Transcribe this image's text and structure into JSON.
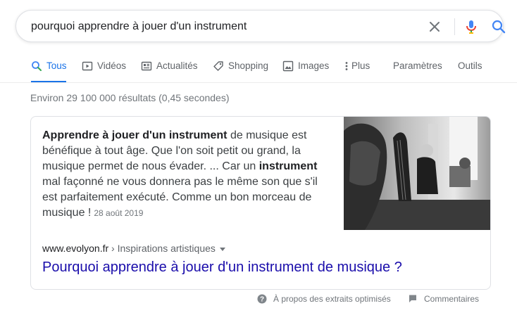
{
  "search": {
    "query": "pourquoi apprendre à jouer d'un instrument"
  },
  "tabs": [
    {
      "label": "Tous"
    },
    {
      "label": "Vidéos"
    },
    {
      "label": "Actualités"
    },
    {
      "label": "Shopping"
    },
    {
      "label": "Images"
    },
    {
      "label": "Plus"
    },
    {
      "label": "Paramètres"
    },
    {
      "label": "Outils"
    }
  ],
  "results_stats": "Environ 29 100 000 résultats (0,45 secondes)",
  "featured_snippet": {
    "bold_1": "Apprendre à jouer d'un instrument",
    "text_1": " de musique est bénéfique à tout âge. Que l'on soit petit ou grand, la musique permet de nous évader. ... Car un ",
    "bold_2": "instrument",
    "text_2": " mal façonné ne vous donnera pas le même son que s'il est parfaitement exécuté. Comme un bon morceau de musique !",
    "date": "28 août 2019",
    "domain": "www.evolyon.fr",
    "breadcrumb": " › Inspirations artistiques",
    "title": "Pourquoi apprendre à jouer d'un instrument de musique ?"
  },
  "footer": {
    "about": "À propos des extraits optimisés",
    "feedback": "Commentaires"
  },
  "colors": {
    "link_title": "#1a0dab",
    "active_tab": "#1a73e8",
    "muted_text": "#70757a"
  },
  "icons": {
    "clear": "close-icon",
    "voice": "microphone-icon",
    "search": "search-icon",
    "about": "help-circle-icon",
    "feedback": "feedback-flag-icon"
  }
}
